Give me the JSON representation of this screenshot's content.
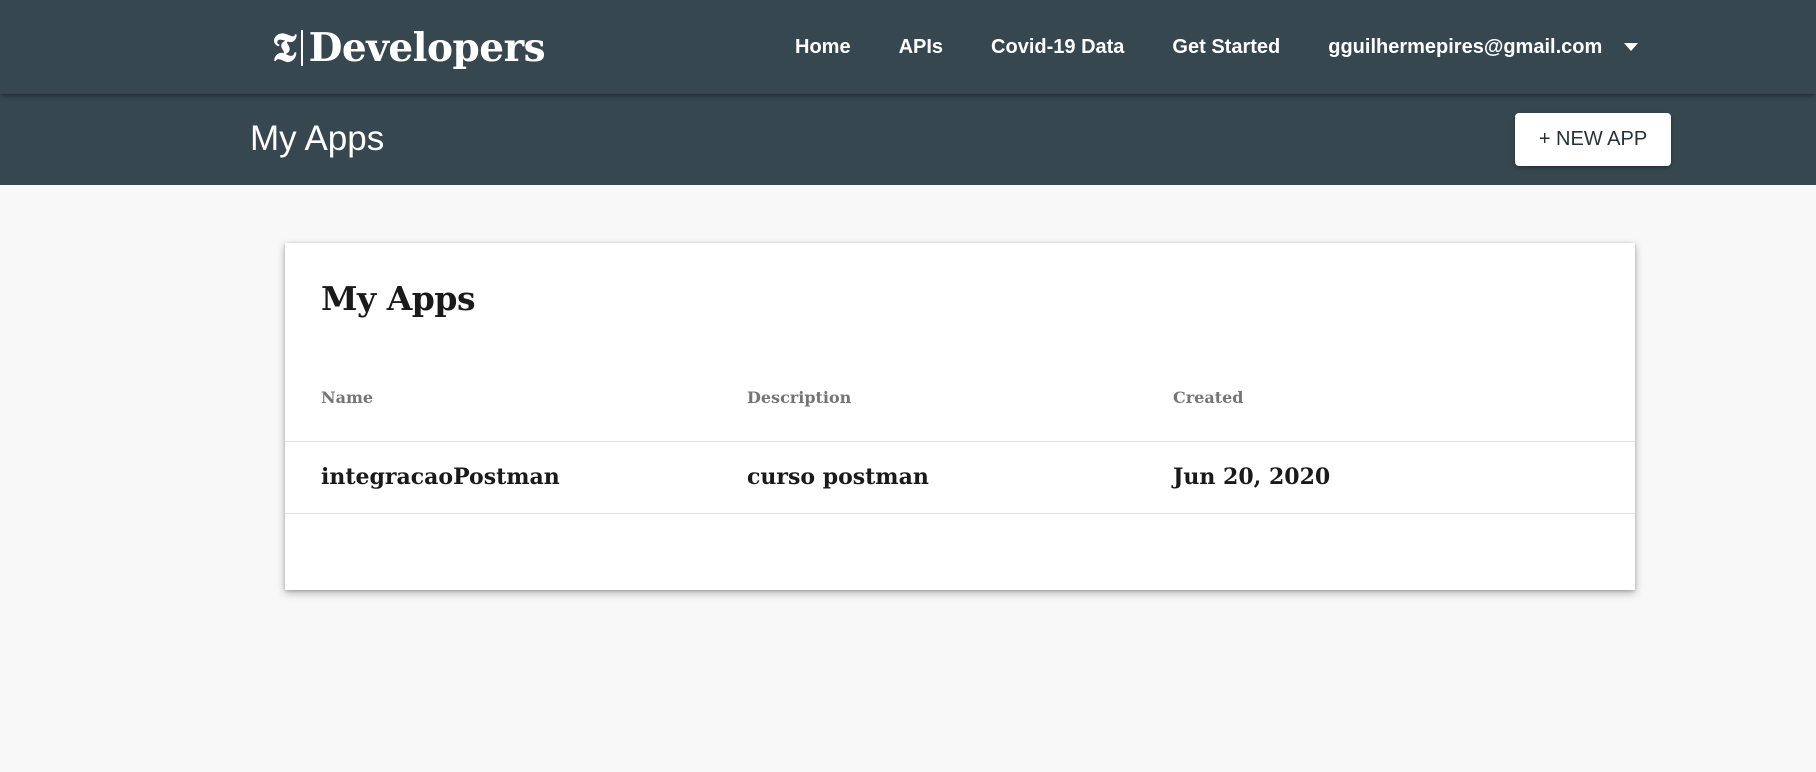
{
  "header": {
    "logo_mark": "𝕿",
    "logo_text": "Developers",
    "nav": {
      "home": "Home",
      "apis": "APIs",
      "covid": "Covid-19 Data",
      "get_started": "Get Started",
      "user_email": "gguilhermepires@gmail.com"
    }
  },
  "subheader": {
    "title": "My Apps",
    "new_app_label": "+ NEW APP"
  },
  "card": {
    "title": "My Apps",
    "columns": [
      "Name",
      "Description",
      "Created"
    ],
    "rows": [
      {
        "name": "integracaoPostman",
        "description": "curso postman",
        "created": "Jun 20, 2020"
      }
    ]
  },
  "colors": {
    "header_bg": "#37474f",
    "page_bg": "#f8f8f8",
    "text_dark": "#1a1a1a",
    "header_text_muted": "#757575"
  }
}
